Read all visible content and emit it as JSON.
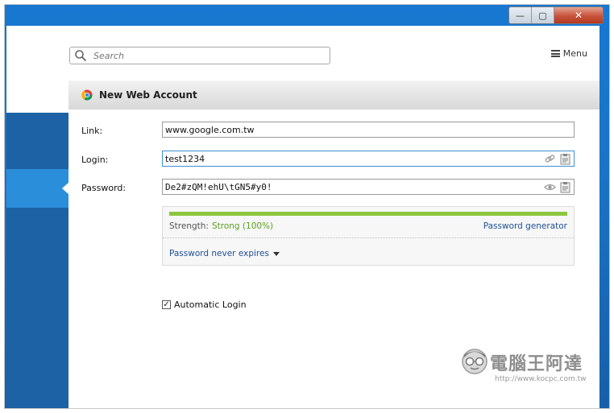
{
  "window": {
    "minimize_glyph": "—",
    "maximize_glyph": "▢",
    "close_glyph": "✕"
  },
  "search": {
    "placeholder": "Search"
  },
  "menu": {
    "label": "Menu"
  },
  "header": {
    "title": "New Web Account"
  },
  "form": {
    "link_label": "Link:",
    "link_value": "www.google.com.tw",
    "login_label": "Login:",
    "login_value": "test1234",
    "password_label": "Password:",
    "password_value": "De2#zQM!ehU\\tGN5#y0!",
    "strength_label": "Strength:",
    "strength_value": "Strong (100%)",
    "strength_percent": 100,
    "password_generator": "Password generator",
    "expires_label": "Password never expires",
    "auto_login_label": "Automatic Login",
    "auto_login_checked": true
  },
  "watermark": {
    "name": "電腦王阿達",
    "url": "http://www.kocpc.com.tw"
  },
  "colors": {
    "accent_blue": "#2b8edb",
    "strength_green": "#8cc63f",
    "link_blue": "#1f4f95"
  }
}
